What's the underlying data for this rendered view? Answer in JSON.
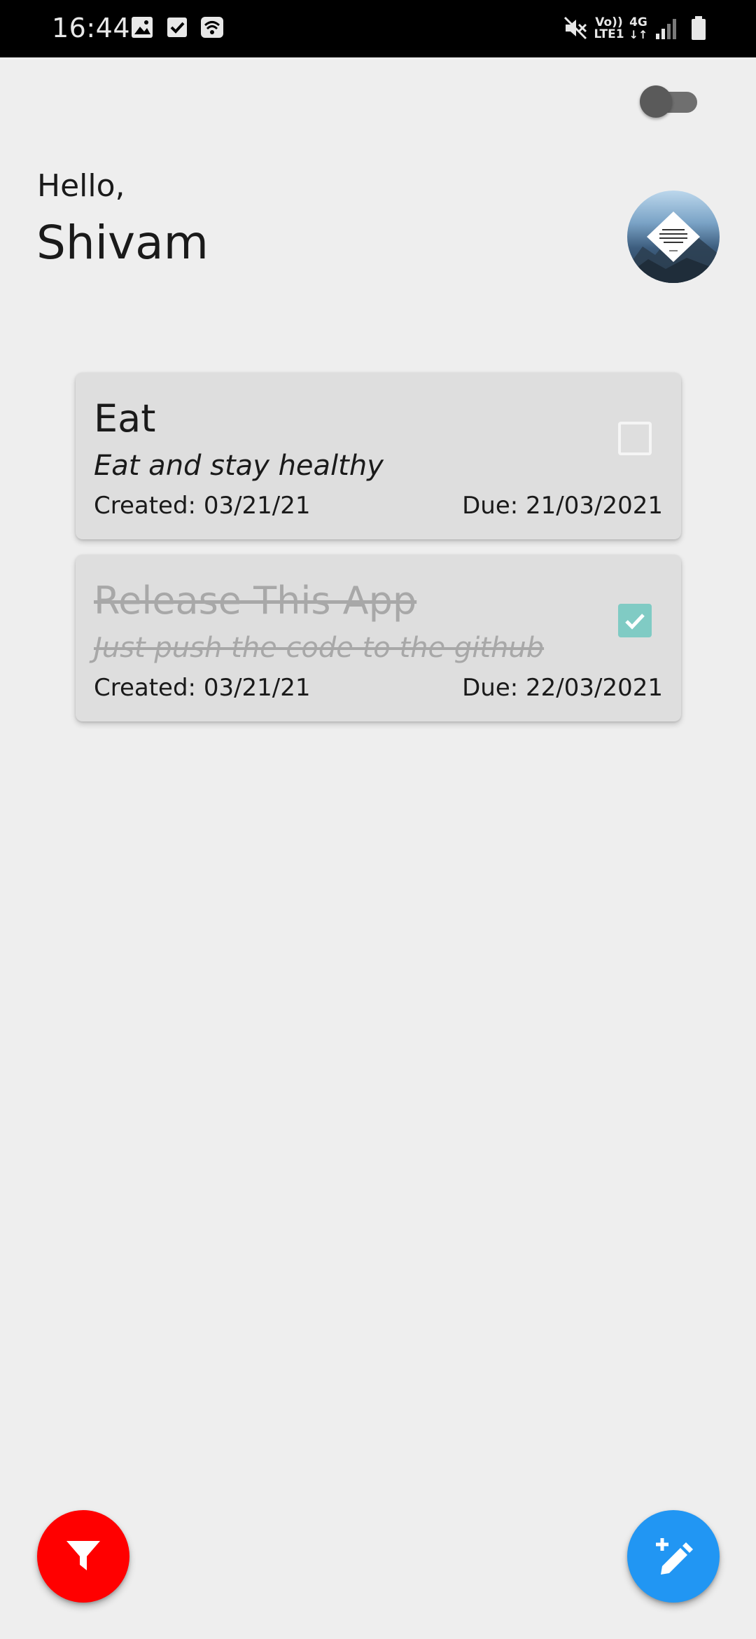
{
  "status_bar": {
    "time": "16:44",
    "left_icons": [
      "image-icon",
      "check-box-icon",
      "wifi-calling-icon"
    ],
    "right_icons": [
      "mute-icon",
      "volte-icon",
      "network-4g-icon",
      "signal-icon",
      "battery-icon"
    ],
    "volte_label": "Vo))",
    "lte_label": "LTE1",
    "network_label": "4G"
  },
  "theme_toggle": {
    "state": "off"
  },
  "greeting": {
    "hello": "Hello,",
    "name": "Shivam"
  },
  "tasks": [
    {
      "title": "Eat",
      "description": "Eat and stay healthy",
      "created": "Created: 03/21/21",
      "due": "Due: 21/03/2021",
      "completed": false
    },
    {
      "title": "Release This App",
      "description": "Just push the code to the github",
      "created": "Created: 03/21/21",
      "due": "Due: 22/03/2021",
      "completed": true
    }
  ],
  "actions": {
    "filter_icon": "filter-icon",
    "add_icon": "add-edit-icon"
  },
  "colors": {
    "background": "#eeeeee",
    "card": "#dedede",
    "check_accent": "#80cbc4",
    "filter_fab": "#ff0000",
    "add_fab": "#2196f3"
  }
}
